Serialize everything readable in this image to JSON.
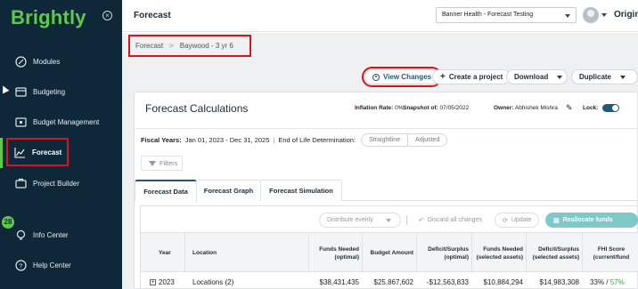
{
  "sidebar": {
    "logo": "Brightly",
    "collapse_icon": "close-circle-icon",
    "items": [
      {
        "label": "Modules",
        "icon": "modules-icon"
      },
      {
        "label": "Budgeting",
        "icon": "budgeting-icon"
      },
      {
        "label": "Budget Management",
        "icon": "budget-management-icon"
      },
      {
        "label": "Forecast",
        "icon": "forecast-chart-icon"
      },
      {
        "label": "Project Builder",
        "icon": "project-builder-icon"
      },
      {
        "label": "Info Center",
        "icon": "lightbulb-icon"
      },
      {
        "label": "Help Center",
        "icon": "help-icon"
      }
    ],
    "badge_count": "28",
    "accent": "#5ec94a"
  },
  "header": {
    "title": "Forecast",
    "org_select": "Banner Health - Forecast Testing",
    "origin_text": "Origin"
  },
  "breadcrumb": {
    "root": "Forecast",
    "separator": ">",
    "current": "Baywood - 3 yr 6"
  },
  "toolbar": {
    "view_changes": "View Changes",
    "create_project": "Create a project",
    "download": "Download",
    "duplicate": "Duplicate"
  },
  "card": {
    "title": "Forecast Calculations",
    "inflation_label": "Inflation Rate:",
    "inflation_value": "0%",
    "snapshot_label": "Snapshot of:",
    "snapshot_value": "07/05/2022",
    "owner_label": "Owner:",
    "owner_value": "Abhishek Mishra",
    "lock_label": "Lock:",
    "fiscal_label": "Fiscal Years:",
    "fiscal_value": "Jan 01, 2023 - Dec 31, 2025",
    "eol_label": "End of Life Determination:",
    "eol_options": [
      "Straightline",
      "Adjusted"
    ],
    "filters": "Filters"
  },
  "tabs": [
    "Forecast Data",
    "Forecast Graph",
    "Forecast Simulation"
  ],
  "table_toolbar": {
    "distribute": "Distribute evenly",
    "discard": "Discard all changes",
    "update": "Update",
    "reallocate": "Reallocate funds"
  },
  "table": {
    "columns": [
      "Year",
      "Location",
      "Funds Needed (optimal)",
      "Budget Amount",
      "Deficit/Surplus (optimal)",
      "Funds Needed (selected assets)",
      "Deficit/Surplus (selected assets)",
      "FHI Score (current/fund"
    ],
    "rows": [
      {
        "year": "2023",
        "location": "Locations (2)",
        "funds_needed_optimal": "$38,431,435",
        "budget_amount": "$25,867,602",
        "deficit_optimal": "-$12,563,833",
        "funds_needed_selected": "$10,884,294",
        "deficit_selected": "$14,983,308",
        "fhi_current": "33%",
        "fhi_sep": "/",
        "fhi_funded": "57%"
      }
    ]
  }
}
